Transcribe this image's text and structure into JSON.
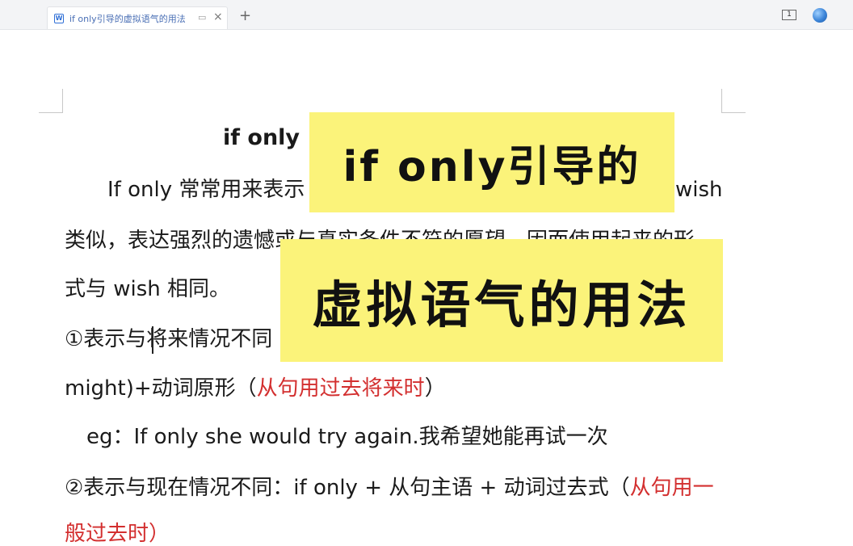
{
  "tab": {
    "title": "if only引导的虚拟语气的用法",
    "doc_icon_letter": "W"
  },
  "toolbar": {
    "page_indicator": "1"
  },
  "document": {
    "title": "if only",
    "lines": [
      "If only 常常用来表示",
      "wish",
      "类似，表达强烈的遗憾或与真实条件不符的愿望，因而使用起来的形",
      "式与 wish 相同。",
      "①表示与将来情况不同",
      "might)+动词原形（",
      "从句用过去将来时",
      "）",
      "eg：If only she would try again.我希望她能再试一次",
      "②表示与现在情况不同：if only + 从句主语 + 动词过去式（",
      "从句用一",
      "般过去时）"
    ]
  },
  "overlay": {
    "line1": "if only引导的",
    "line2": "虚拟语气的用法"
  },
  "colors": {
    "overlay_bg": "#fbf37a",
    "red_text": "#d32f2f",
    "tab_text": "#4a6fb5"
  }
}
